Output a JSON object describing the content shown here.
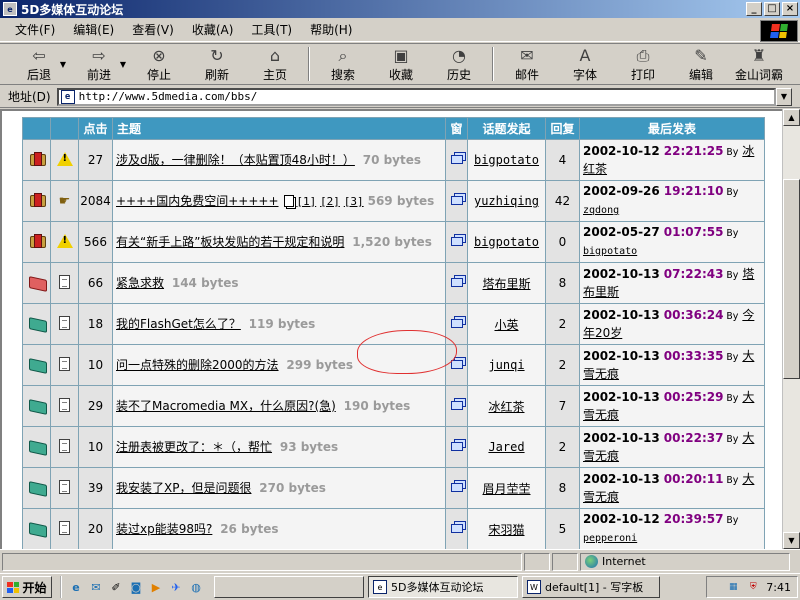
{
  "window": {
    "title": "5D多媒体互动论坛",
    "controls": {
      "minimize": "_",
      "maximize": "□",
      "close": "×"
    }
  },
  "menu": [
    "文件(F)",
    "编辑(E)",
    "查看(V)",
    "收藏(A)",
    "工具(T)",
    "帮助(H)"
  ],
  "toolbar": {
    "back": "后退",
    "forward": "前进",
    "stop": "停止",
    "refresh": "刷新",
    "home": "主页",
    "search": "搜索",
    "favorites": "收藏",
    "history": "历史",
    "mail": "邮件",
    "font": "字体",
    "print": "打印",
    "edit": "编辑",
    "jinshan": "金山词霸"
  },
  "address": {
    "label": "地址(D)",
    "url": "http://www.5dmedia.com/bbs/"
  },
  "table": {
    "headers": {
      "hits": "点击",
      "topic": "主题",
      "win": "窗",
      "author": "话题发起",
      "replies": "回复",
      "last": "最后发表"
    },
    "by_label": "By",
    "rows": [
      {
        "folder": "hot",
        "icon": "warn",
        "hits": "27",
        "title": "涉及d版，一律删除！（本贴置顶48小时！）",
        "size": "70 bytes",
        "author": "bigpotato",
        "replies": "4",
        "date": "2002-10-12",
        "time": "22:21:25",
        "user": "冰红茶",
        "user_mono": false
      },
      {
        "folder": "hot",
        "icon": "hand",
        "hits": "2084",
        "title": "++++国内免费空间+++++",
        "pages": [
          "[1]",
          "[2]",
          "[3]"
        ],
        "size": "569 bytes",
        "author": "yuzhiqing",
        "replies": "42",
        "date": "2002-09-26",
        "time": "19:21:10",
        "user": "zqdong",
        "user_mono": true
      },
      {
        "folder": "hot",
        "icon": "warn",
        "hits": "566",
        "title": "有关“新手上路”板块发贴的若干规定和说明",
        "size": "1,520 bytes",
        "author": "bigpotato",
        "replies": "0",
        "date": "2002-05-27",
        "time": "01:07:55",
        "user": "bigpotato",
        "user_mono": true
      },
      {
        "folder": "red",
        "icon": "doc",
        "hits": "66",
        "title": "紧急求救",
        "size": "144 bytes",
        "author": "塔布里斯",
        "replies": "8",
        "date": "2002-10-13",
        "time": "07:22:43",
        "user": "塔布里斯",
        "user_mono": false
      },
      {
        "folder": "teal",
        "icon": "doc",
        "hits": "18",
        "title": "我的FlashGet怎么了？",
        "size": "119 bytes",
        "author": "小英",
        "replies": "2",
        "date": "2002-10-13",
        "time": "00:36:24",
        "user": "今年20岁",
        "user_mono": false
      },
      {
        "folder": "teal",
        "icon": "doc",
        "hits": "10",
        "title": "问一点特殊的删除2000的方法",
        "size": "299 bytes",
        "author": "junqi",
        "replies": "2",
        "date": "2002-10-13",
        "time": "00:33:35",
        "user": "大雪无痕",
        "user_mono": false
      },
      {
        "folder": "teal",
        "icon": "doc",
        "hits": "29",
        "title": "装不了Macromedia MX，什么原因?(急)",
        "size": "190 bytes",
        "author": "冰红茶",
        "replies": "7",
        "date": "2002-10-13",
        "time": "00:25:29",
        "user": "大雪无痕",
        "user_mono": false
      },
      {
        "folder": "teal",
        "icon": "doc",
        "hits": "10",
        "title": "注册表被更改了：＊（，帮忙",
        "size": "93 bytes",
        "author": "Jared",
        "replies": "2",
        "date": "2002-10-13",
        "time": "00:22:37",
        "user": "大雪无痕",
        "user_mono": false
      },
      {
        "folder": "teal",
        "icon": "doc",
        "hits": "39",
        "title": "我安装了XP，但是问题很",
        "size": "270 bytes",
        "author": "眉月茔茔",
        "replies": "8",
        "date": "2002-10-13",
        "time": "00:20:11",
        "user": "大雪无痕",
        "user_mono": false
      },
      {
        "folder": "teal",
        "icon": "doc",
        "hits": "20",
        "title": "装过xp能装98吗?",
        "size": "26 bytes",
        "author": "宋羽猫",
        "replies": "5",
        "date": "2002-10-12",
        "time": "20:39:57",
        "user": "pepperoni",
        "user_mono": true
      }
    ]
  },
  "status": {
    "zone": "Internet"
  },
  "taskbar": {
    "start": "开始",
    "tasks": [
      "5D多媒体互动论坛",
      "default[1] - 写字板"
    ],
    "clock": "7:41"
  }
}
